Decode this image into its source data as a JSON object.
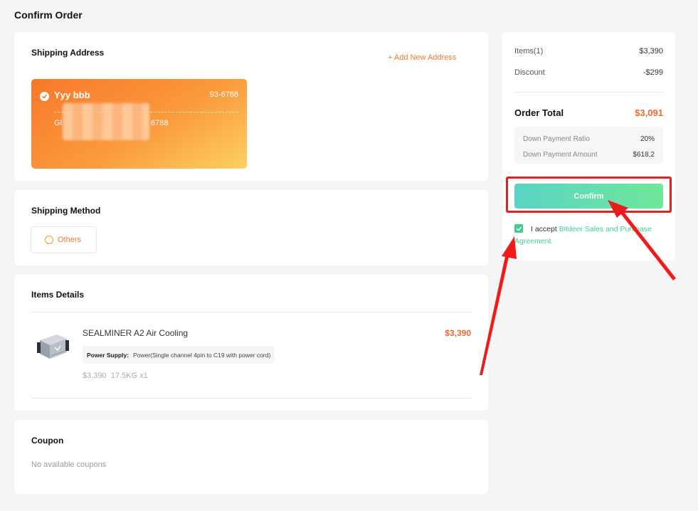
{
  "page": {
    "title": "Confirm Order"
  },
  "address": {
    "title": "Shipping Address",
    "add_label": "+ Add New Address",
    "name": "Yyy bbb",
    "phone": "93-6788",
    "line_prefix": "Gl",
    "line_suffix": "6788"
  },
  "shipping": {
    "title": "Shipping Method",
    "option": "Others"
  },
  "items": {
    "title": "Items Details",
    "product": {
      "name": "SEALMINER A2 Air Cooling",
      "price": "$3,390",
      "spec_label": "Power Supply:",
      "spec_value": "Power(Single channel 4pin to C19 with power cord)",
      "meta": "$3,390  17.5KG x1"
    }
  },
  "coupon": {
    "title": "Coupon",
    "empty": "No available coupons"
  },
  "summary": {
    "items_label": "Items(1)",
    "items_value": "$3,390",
    "discount_label": "Discount",
    "discount_value": "-$299",
    "total_label": "Order Total",
    "total_value": "$3,091",
    "ratio_label": "Down Payment Ratio",
    "ratio_value": "20%",
    "amount_label": "Down Payment Amount",
    "amount_value": "$618.2",
    "confirm_label": "Confirm",
    "agree_prefix": "I accept ",
    "agree_link": "Bitdeer Sales and Purchase Agreement."
  },
  "colors": {
    "accent": "#f07a2d",
    "price": "#f06a2a",
    "confirm_start": "#59d4c3",
    "confirm_end": "#6fe89a",
    "annotation": "#f01a1a"
  }
}
